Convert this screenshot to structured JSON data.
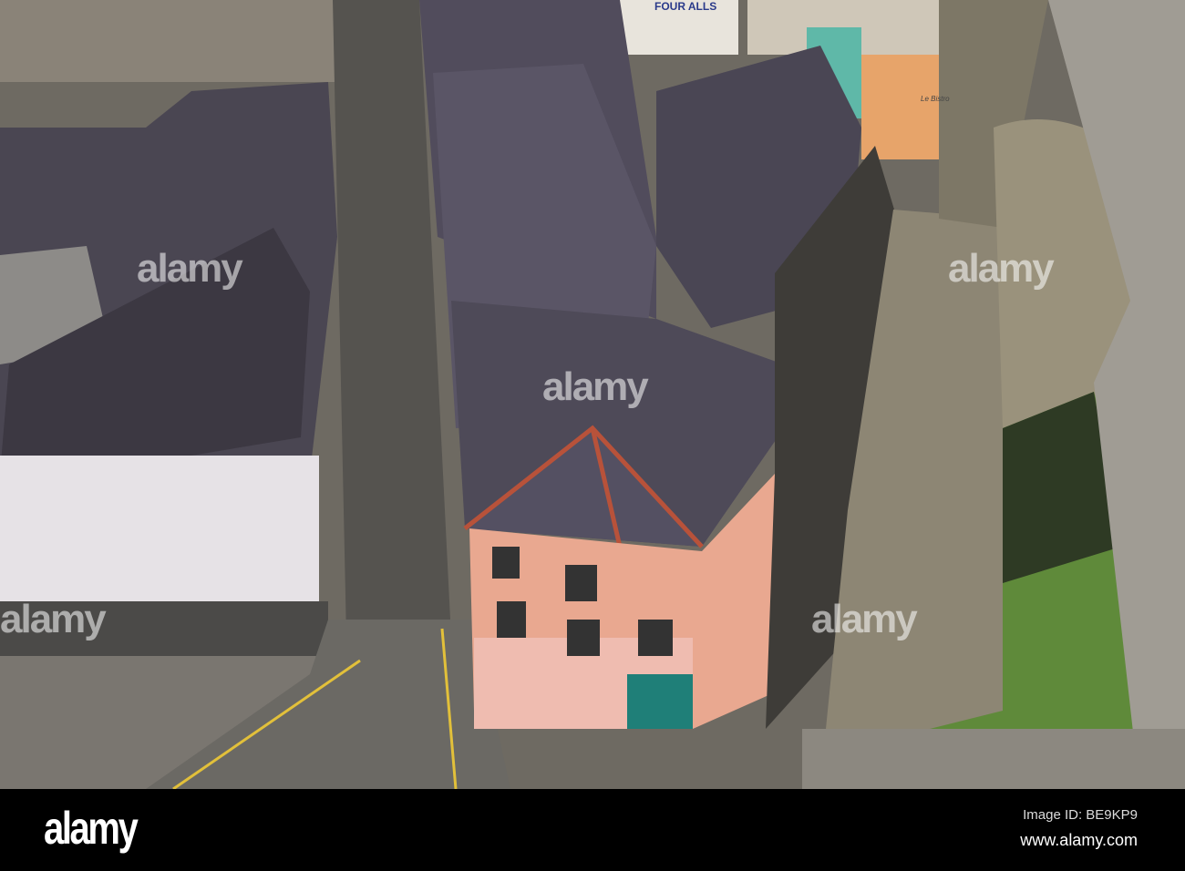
{
  "photo": {
    "subject": "Aerial view of town street with slate roofs, pink corner building and medieval town wall",
    "signs": {
      "pub_sign": "FOUR ALLS",
      "bistro_sign": "Le Bistro"
    },
    "watermark": "alamy"
  },
  "footer": {
    "logo": "alamy",
    "image_id": "Image ID: BE9KP9",
    "url": "www.alamy.com"
  }
}
